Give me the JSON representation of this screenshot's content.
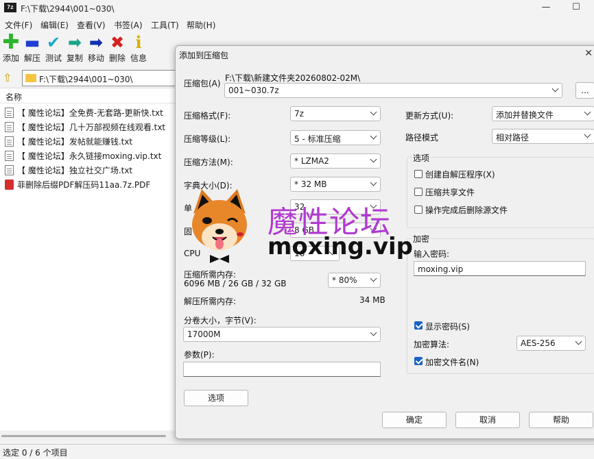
{
  "window": {
    "title": "F:\\下载\\2944\\001~030\\",
    "app_icon": "7z"
  },
  "menu": [
    "文件(F)",
    "编辑(E)",
    "查看(V)",
    "书签(A)",
    "工具(T)",
    "帮助(H)"
  ],
  "toolbar": [
    {
      "label": "添加",
      "icon": "plus-icon",
      "color": "#2cb52c"
    },
    {
      "label": "解压",
      "icon": "minus-icon",
      "color": "#1e3fd1"
    },
    {
      "label": "测试",
      "icon": "check-icon",
      "color": "#19a9c8"
    },
    {
      "label": "复制",
      "icon": "copy-arrow-icon",
      "color": "#1aa58a"
    },
    {
      "label": "移动",
      "icon": "move-arrow-icon",
      "color": "#1030b0"
    },
    {
      "label": "删除",
      "icon": "delete-x-icon",
      "color": "#d42020"
    },
    {
      "label": "信息",
      "icon": "info-icon",
      "color": "#d8b000"
    }
  ],
  "address": {
    "path": "F:\\下载\\2944\\001~030\\"
  },
  "filelist": {
    "column_name": "名称",
    "files": [
      "【 魔性论坛】全免费-无套路-更新快.txt",
      "【 魔性论坛】几十万部视频在线观看.txt",
      "【 魔性论坛】发帖就能赚钱.txt",
      "【 魔性论坛】永久链接moxing.vip.txt",
      "【 魔性论坛】独立社交广场.txt",
      "菲删除后缀PDF解压码11aa.7z.PDF"
    ]
  },
  "status": "选定 0 / 6 个项目",
  "dialog": {
    "title": "添加到压缩包",
    "archive_label": "压缩包(A)",
    "archive_dir": "F:\\下载\\新建文件夹20260802-02M\\",
    "archive_name": "001~030.7z",
    "browse_label": "...",
    "format_label": "压缩格式(F):",
    "format_value": "7z",
    "level_label": "压缩等级(L):",
    "level_value": "5 - 标准压缩",
    "method_label": "压缩方法(M):",
    "method_value": "* LZMA2",
    "dict_label": "字典大小(D):",
    "dict_value": "* 32 MB",
    "word_label": "单",
    "word_value": "32",
    "solid_label": "固",
    "solid_value": "8 GB",
    "cpu_label": "CPU",
    "cpu_value": "16",
    "mem_label": "压缩所需内存:",
    "mem_detail": "6096 MB / 26 GB / 32 GB",
    "mem_value": "* 80%",
    "decomp_label": "解压所需内存:",
    "decomp_value": "34 MB",
    "split_label": "分卷大小，字节(V):",
    "split_value": "17000M",
    "params_label": "参数(P):",
    "params_value": "",
    "options_button": "选项",
    "update_label": "更新方式(U):",
    "update_value": "添加并替换文件",
    "path_label": "路径模式",
    "path_value": "相对路径",
    "options_group": "选项",
    "opt_sfx": "创建自解压程序(X)",
    "opt_shared": "压缩共享文件",
    "opt_delete": "操作完成后删除源文件",
    "encrypt_group": "加密",
    "pwd_label": "输入密码:",
    "pwd_value": "moxing.vip",
    "show_pwd": "显示密码(S)",
    "algo_label": "加密算法:",
    "algo_value": "AES-256",
    "encrypt_names": "加密文件名(N)",
    "ok": "确定",
    "cancel": "取消",
    "help": "帮助"
  },
  "watermark": {
    "cn": "魔性论坛",
    "en": "moxing.vip"
  }
}
